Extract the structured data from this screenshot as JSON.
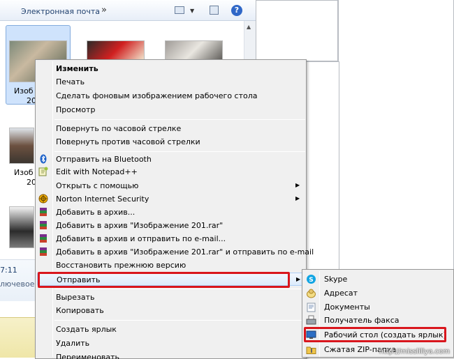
{
  "explorer": {
    "toolbar_item": "Электронная почта",
    "toolbar_more": "»",
    "help_glyph": "?",
    "files": [
      {
        "label": "Изоб"
      },
      {
        "label": "20"
      },
      {
        "label": "Изоб"
      },
      {
        "label": "20"
      }
    ],
    "details_time": "7:11",
    "details_text": "лючевое с"
  },
  "menu": {
    "items": [
      {
        "label": "Изменить"
      },
      {
        "label": "Печать"
      },
      {
        "label": "Сделать фоновым изображением рабочего стола"
      },
      {
        "label": "Просмотр"
      },
      {
        "label": "Повернуть по часовой стрелке"
      },
      {
        "label": "Повернуть против часовой стрелки"
      },
      {
        "label": "Отправить на Bluetooth"
      },
      {
        "label": "Edit with Notepad++"
      },
      {
        "label": "Открыть с помощью"
      },
      {
        "label": "Norton Internet Security"
      },
      {
        "label": "Добавить в архив..."
      },
      {
        "label": "Добавить в архив \"Изображение 201.rar\""
      },
      {
        "label": "Добавить в архив и отправить по e-mail..."
      },
      {
        "label": "Добавить в архив \"Изображение 201.rar\" и отправить по e-mail"
      },
      {
        "label": "Восстановить прежнюю версию"
      },
      {
        "label": "Отправить"
      },
      {
        "label": "Вырезать"
      },
      {
        "label": "Копировать"
      },
      {
        "label": "Создать ярлык"
      },
      {
        "label": "Удалить"
      },
      {
        "label": "Переименовать"
      }
    ]
  },
  "submenu": {
    "items": [
      {
        "label": "Skype"
      },
      {
        "label": "Адресат"
      },
      {
        "label": "Документы"
      },
      {
        "label": "Получатель факса"
      },
      {
        "label": "Рабочий стол (создать ярлык)"
      },
      {
        "label": "Сжатая ZIP-папка"
      }
    ]
  },
  "watermark": "http://misslillya.com",
  "colors": {
    "highlight_box": "#d9161d",
    "menu_bg": "#f0f0f0",
    "selection_bg": "#cfe3fc"
  }
}
